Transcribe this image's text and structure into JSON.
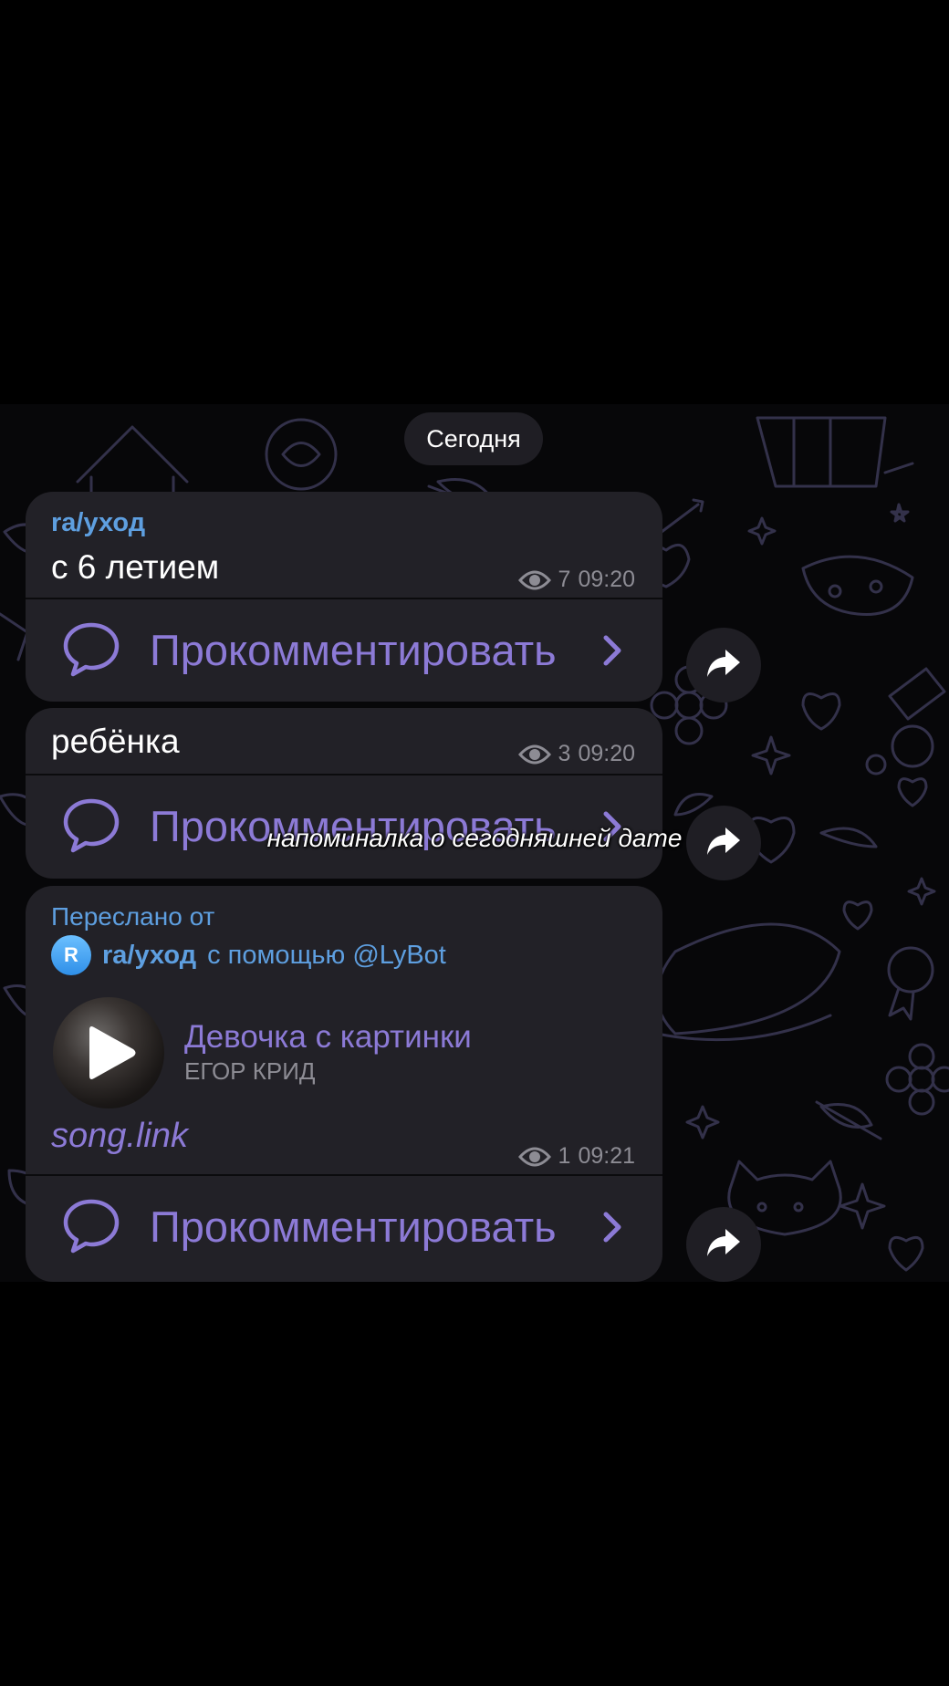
{
  "chat": {
    "date_pill": "Сегодня",
    "messages": [
      {
        "sender": "ra/уход",
        "text": "с 6 летием",
        "views": "7",
        "time": "09:20",
        "comment_label": "Прокомментировать"
      },
      {
        "text": "ребёнка",
        "views": "3",
        "time": "09:20",
        "comment_label": "Прокомментировать"
      },
      {
        "forwarded_label": "Переслано от",
        "forwarded_avatar": "R",
        "forwarded_name": "ra/уход",
        "forwarded_via": "с помощью @LyBot",
        "song_title": "Девочка с картинки",
        "song_artist": "ЕГОР КРИД",
        "link_text": "song.link",
        "views": "1",
        "time": "09:21",
        "comment_label": "Прокомментировать"
      }
    ]
  },
  "caption": "напоминалка о сегодняшней дате",
  "icons": {
    "views": "eye-icon",
    "comment": "speech-bubble-icon",
    "chevron": "chevron-right-icon",
    "share": "share-arrow-icon",
    "play": "play-icon"
  },
  "colors": {
    "accent_link": "#5e9fe0",
    "comment_purple": "#8c7ad6",
    "bubble": "#222127",
    "background": "#000000"
  }
}
